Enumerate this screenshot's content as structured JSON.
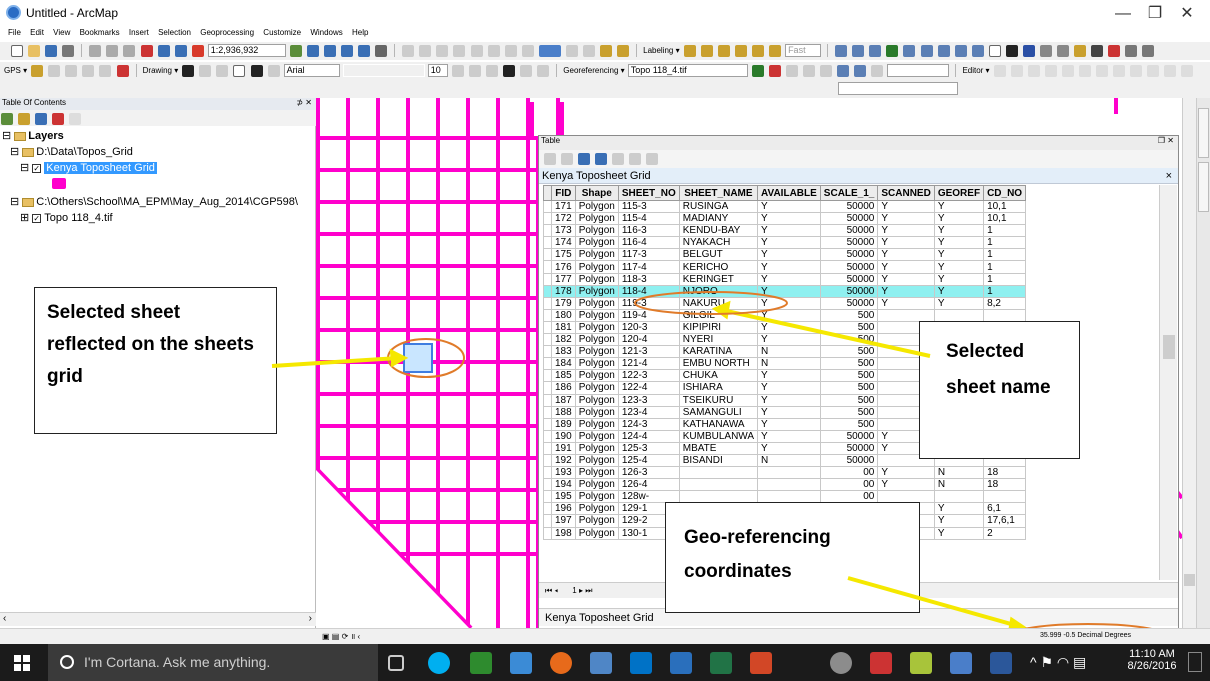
{
  "window": {
    "title": "Untitled - ArcMap",
    "minimize": "—",
    "maximize": "❐",
    "close": "✕"
  },
  "menu": [
    "File",
    "Edit",
    "View",
    "Bookmarks",
    "Insert",
    "Selection",
    "Geoprocessing",
    "Customize",
    "Windows",
    "Help"
  ],
  "toolbar": {
    "scale": "1:2,936,932",
    "labeling": "Labeling ▾",
    "fast": "Fast",
    "gps": "GPS ▾",
    "drawing": "Drawing ▾",
    "font": "Arial",
    "font_size": "10",
    "georeferencing": "Georeferencing ▾",
    "georef_layer": "Topo 118_4.tif",
    "editor": "Editor ▾"
  },
  "toc": {
    "header": "Table Of Contents",
    "pin": "⊅ ✕",
    "layers_root": "Layers",
    "group1": "D:\\Data\\Topos_Grid",
    "layer_selected": "Kenya Toposheet Grid",
    "group2": "C:\\Others\\School\\MA_EPM\\May_Aug_2014\\CGP598\\",
    "layer2": "Topo 118_4.tif"
  },
  "table": {
    "window_title": "Table",
    "tab_title": "Kenya Toposheet Grid",
    "bottom_tab": "Kenya Toposheet Grid",
    "nav": "1",
    "columns": [
      "FID",
      "Shape",
      "SHEET_NO",
      "SHEET_NAME",
      "AVAILABLE",
      "SCALE_1_",
      "SCANNED",
      "GEOREF",
      "CD_NO"
    ],
    "rows": [
      [
        "171",
        "Polygon",
        "115-3",
        "RUSINGA",
        "Y",
        "50000",
        "Y",
        "Y",
        "10,1"
      ],
      [
        "172",
        "Polygon",
        "115-4",
        "MADIANY",
        "Y",
        "50000",
        "Y",
        "Y",
        "10,1"
      ],
      [
        "173",
        "Polygon",
        "116-3",
        "KENDU-BAY",
        "Y",
        "50000",
        "Y",
        "Y",
        "1"
      ],
      [
        "174",
        "Polygon",
        "116-4",
        "NYAKACH",
        "Y",
        "50000",
        "Y",
        "Y",
        "1"
      ],
      [
        "175",
        "Polygon",
        "117-3",
        "BELGUT",
        "Y",
        "50000",
        "Y",
        "Y",
        "1"
      ],
      [
        "176",
        "Polygon",
        "117-4",
        "KERICHO",
        "Y",
        "50000",
        "Y",
        "Y",
        "1"
      ],
      [
        "177",
        "Polygon",
        "118-3",
        "KERINGET",
        "Y",
        "50000",
        "Y",
        "Y",
        "1"
      ],
      [
        "178",
        "Polygon",
        "118-4",
        "NJORO",
        "Y",
        "50000",
        "Y",
        "Y",
        "1"
      ],
      [
        "179",
        "Polygon",
        "119-3",
        "NAKURU",
        "Y",
        "50000",
        "Y",
        "Y",
        "8,2"
      ],
      [
        "180",
        "Polygon",
        "119-4",
        "GILGIL",
        "Y",
        "500",
        "",
        "",
        ""
      ],
      [
        "181",
        "Polygon",
        "120-3",
        "KIPIPIRI",
        "Y",
        "500",
        "",
        "",
        ""
      ],
      [
        "182",
        "Polygon",
        "120-4",
        "NYERI",
        "Y",
        "500",
        "",
        "",
        ""
      ],
      [
        "183",
        "Polygon",
        "121-3",
        "KARATINA",
        "N",
        "500",
        "",
        "",
        ""
      ],
      [
        "184",
        "Polygon",
        "121-4",
        "EMBU NORTH",
        "N",
        "500",
        "",
        "",
        ""
      ],
      [
        "185",
        "Polygon",
        "122-3",
        "CHUKA",
        "Y",
        "500",
        "",
        "",
        ""
      ],
      [
        "186",
        "Polygon",
        "122-4",
        "ISHIARA",
        "Y",
        "500",
        "",
        "",
        ""
      ],
      [
        "187",
        "Polygon",
        "123-3",
        "TSEIKURU",
        "Y",
        "500",
        "",
        "",
        ""
      ],
      [
        "188",
        "Polygon",
        "123-4",
        "SAMANGULI",
        "Y",
        "500",
        "",
        "",
        ""
      ],
      [
        "189",
        "Polygon",
        "124-3",
        "KATHANAWA",
        "Y",
        "500",
        "",
        "",
        ""
      ],
      [
        "190",
        "Polygon",
        "124-4",
        "KUMBULANWA",
        "Y",
        "50000",
        "Y",
        "",
        "8"
      ],
      [
        "191",
        "Polygon",
        "125-3",
        "MBATE",
        "Y",
        "50000",
        "Y",
        "N",
        "18"
      ],
      [
        "192",
        "Polygon",
        "125-4",
        "BISANDI",
        "N",
        "50000",
        "",
        "",
        ""
      ],
      [
        "193",
        "Polygon",
        "126-3",
        "",
        "",
        "00",
        "Y",
        "N",
        "18"
      ],
      [
        "194",
        "Polygon",
        "126-4",
        "",
        "",
        "00",
        "Y",
        "N",
        "18"
      ],
      [
        "195",
        "Polygon",
        "128w-",
        "",
        "",
        "00",
        "",
        "",
        ""
      ],
      [
        "196",
        "Polygon",
        "129-1",
        "",
        "",
        "00",
        "Y",
        "Y",
        "6,1"
      ],
      [
        "197",
        "Polygon",
        "129-2",
        "",
        "",
        "00",
        "Y",
        "Y",
        "17,6,1"
      ],
      [
        "198",
        "Polygon",
        "130-1",
        "",
        "",
        "00",
        "Y",
        "Y",
        "2"
      ]
    ]
  },
  "callouts": {
    "selected_sheet": "Selected sheet reflected on the sheets grid",
    "sheet_name": "Selected sheet name",
    "georef": "Geo-referencing coordinates"
  },
  "status": {
    "coords": "35.999  -0.5 Decimal Degrees"
  },
  "taskbar": {
    "cortana": "I'm Cortana. Ask me anything.",
    "time": "11:10 AM",
    "date": "8/26/2016"
  },
  "colors": {
    "grid": "#ff00cc",
    "selection": "#8ff0f0",
    "callout_arrow": "#f5e800",
    "highlight_ellipse": "#e07b2a"
  }
}
